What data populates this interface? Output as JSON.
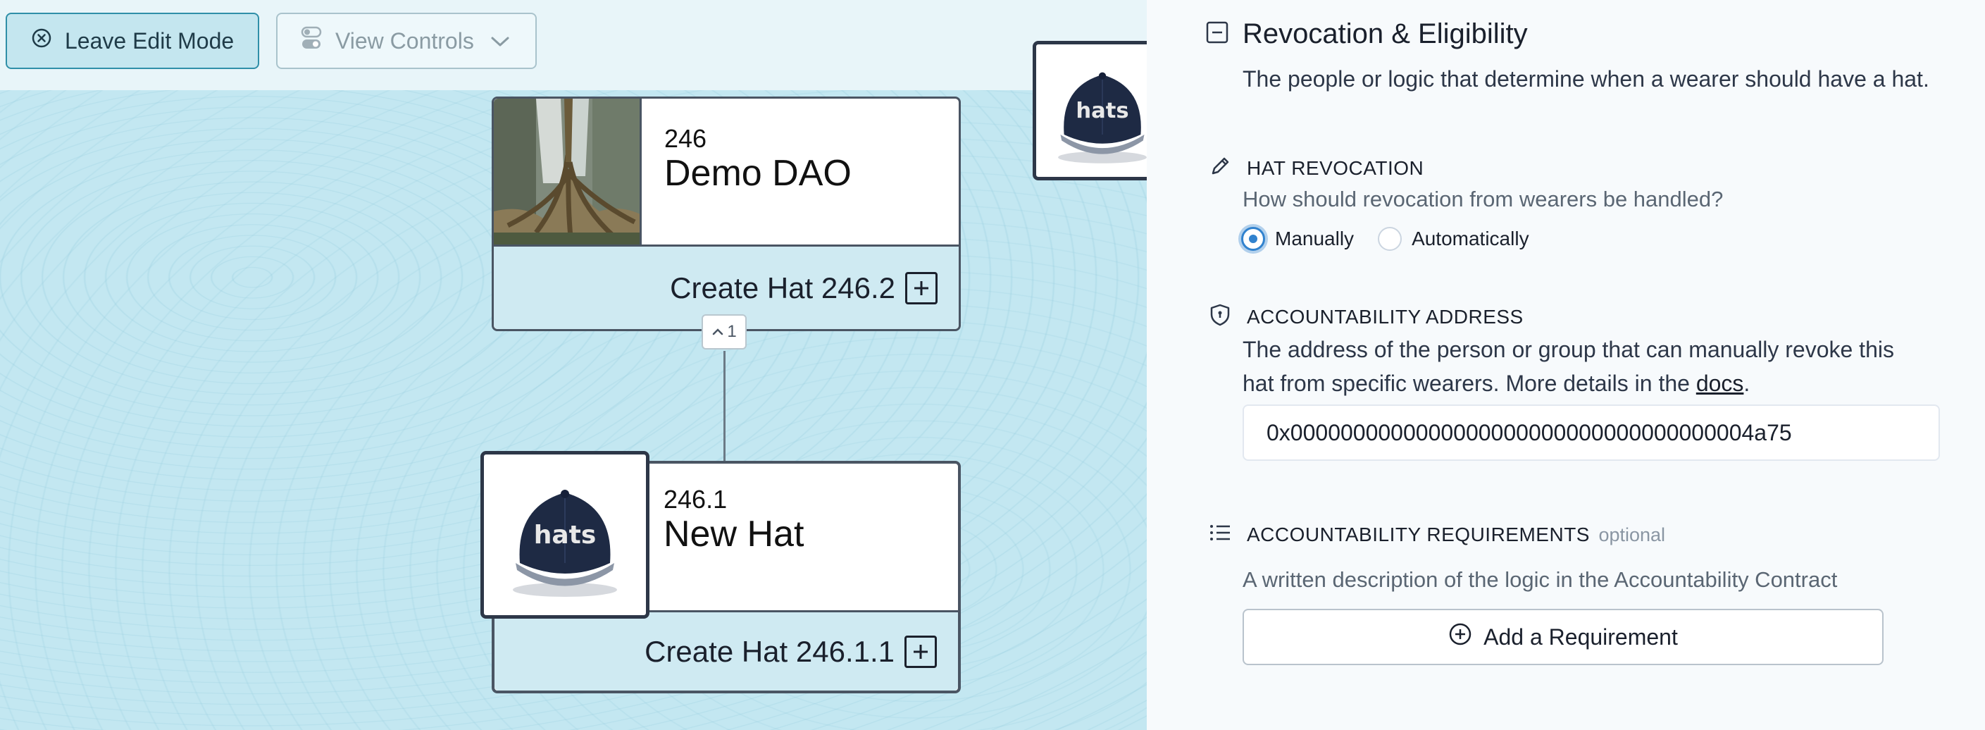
{
  "toolbar": {
    "leave_label": "Leave Edit Mode",
    "view_label": "View Controls"
  },
  "top_hat": {
    "id": "246",
    "name": "Demo DAO",
    "create_label": "Create Hat 246.2"
  },
  "level_badge": "1",
  "child_hat": {
    "id": "246.1",
    "name": "New Hat",
    "create_label": "Create Hat 246.1.1"
  },
  "logo_text": "hats",
  "panel": {
    "title": "Revocation & Eligibility",
    "description": "The people or logic that determine when a wearer should have a hat.",
    "revocation": {
      "label": "HAT REVOCATION",
      "question": "How should revocation from wearers be handled?",
      "options": [
        "Manually",
        "Automatically"
      ],
      "selected": "Manually"
    },
    "accountability": {
      "label": "ACCOUNTABILITY ADDRESS",
      "help_line1": "The address of the person or group that can manually revoke this",
      "help_line2": "hat from specific wearers. More details in the",
      "docs_link": "docs",
      "value": "0x0000000000000000000000000000000000004a75"
    },
    "requirements": {
      "label": "ACCOUNTABILITY REQUIREMENTS",
      "optional": "optional",
      "help": "A written description of the logic in the Accountability Contract",
      "add_button": "Add a Requirement"
    }
  },
  "colors": {
    "canvas_bg": "#c3e7f1",
    "accent": "#2f8fa8",
    "radio_selected": "#3182ce",
    "card_border": "#4a5563"
  }
}
